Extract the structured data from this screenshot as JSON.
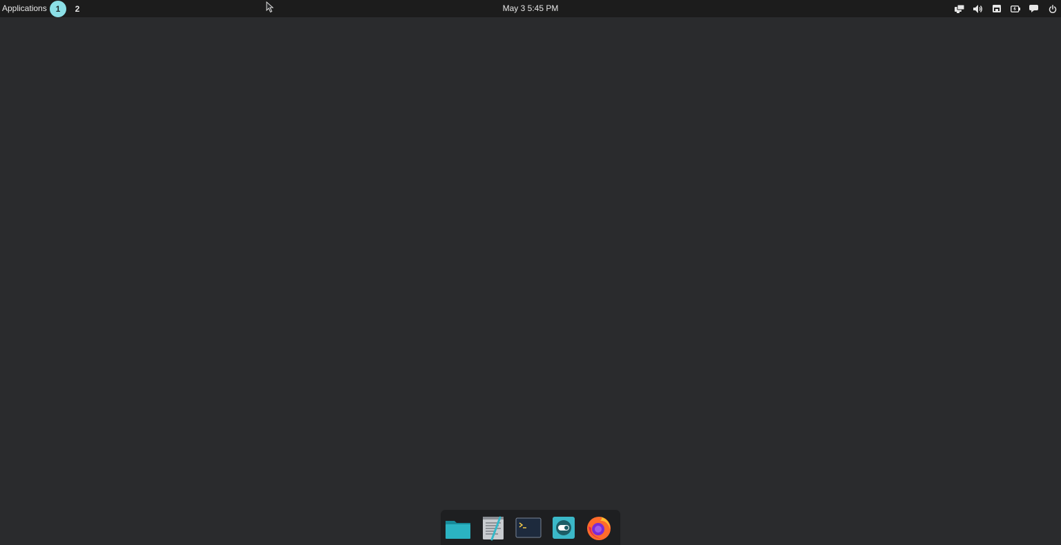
{
  "topbar": {
    "applications_label": "Applications",
    "workspaces": [
      {
        "label": "1",
        "active": true
      },
      {
        "label": "2",
        "active": false
      }
    ],
    "clock": "May 3 5:45 PM",
    "tray_icons": [
      "display-icon",
      "volume-icon",
      "network-icon",
      "battery-icon",
      "notification-icon",
      "power-icon"
    ]
  },
  "dock": {
    "items": [
      "files-icon",
      "text-editor-icon",
      "terminal-icon",
      "settings-toggle-icon",
      "firefox-icon"
    ]
  },
  "colors": {
    "desktop_bg": "#2a2b2d",
    "topbar_bg": "#1c1c1c",
    "accent": "#8bdfe6",
    "dock_bg": "#1e1f21"
  }
}
